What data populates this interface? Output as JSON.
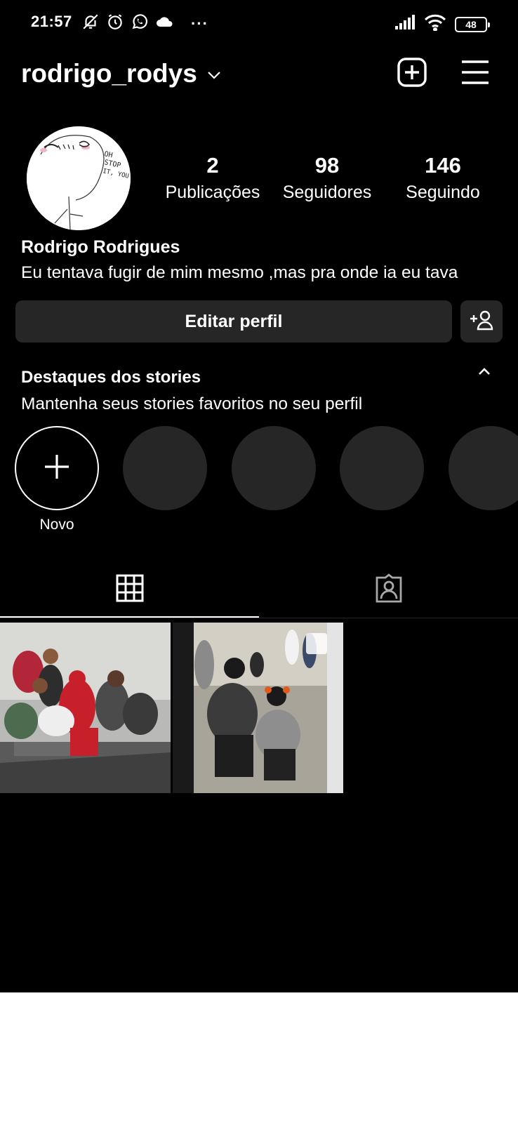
{
  "status_bar": {
    "time": "21:57",
    "more": "···",
    "battery": "48",
    "icons": [
      "muted-bell-icon",
      "alarm-icon",
      "whatsapp-icon",
      "cloud-icon",
      "signal-icon",
      "wifi-icon",
      "battery-icon"
    ]
  },
  "header": {
    "username": "rodrigo_rodys",
    "icons": [
      "chevron-down-icon",
      "new-post-icon",
      "menu-icon"
    ]
  },
  "profile": {
    "posts_count": "2",
    "posts_label": "Publicações",
    "followers_count": "98",
    "followers_label": "Seguidores",
    "following_count": "146",
    "following_label": "Seguindo",
    "full_name": "Rodrigo Rodrigues",
    "bio": "Eu tentava fugir de mim mesmo ,mas pra onde ia eu tava",
    "avatar_text": [
      "OH",
      "STOP",
      "IT, YOU"
    ]
  },
  "actions": {
    "edit_profile": "Editar perfil"
  },
  "highlights": {
    "title": "Destaques dos stories",
    "subtitle": "Mantenha seus stories favoritos no seu perfil",
    "new_label": "Novo"
  },
  "tabs": [
    "grid-icon",
    "tagged-icon"
  ],
  "colors": {
    "background": "#000000",
    "surface": "#262626",
    "text": "#ffffff"
  }
}
